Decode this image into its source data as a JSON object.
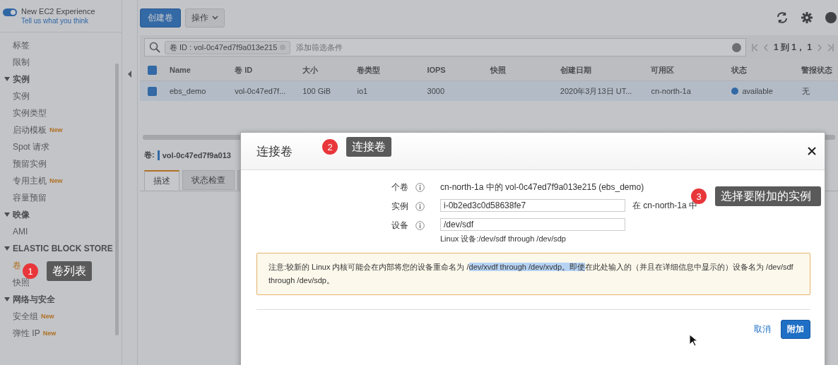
{
  "experience": {
    "label": "New EC2 Experience",
    "on": true,
    "link": "Tell us what you think"
  },
  "sidebar": {
    "items": [
      {
        "kind": "item",
        "label": "标签",
        "selected": false
      },
      {
        "kind": "item",
        "label": "限制",
        "selected": false
      },
      {
        "kind": "section",
        "label": "实例",
        "expanded": true,
        "children": [
          {
            "kind": "item",
            "label": "实例",
            "selected": false
          },
          {
            "kind": "item",
            "label": "实例类型",
            "selected": false
          },
          {
            "kind": "item",
            "label": "启动模板",
            "badge": "New",
            "selected": false
          },
          {
            "kind": "item",
            "label": "Spot 请求",
            "selected": false
          },
          {
            "kind": "item",
            "label": "预留实例",
            "selected": false
          },
          {
            "kind": "item",
            "label": "专用主机",
            "badge": "New",
            "selected": false
          },
          {
            "kind": "item",
            "label": "容量预留",
            "selected": false
          }
        ]
      },
      {
        "kind": "section",
        "label": "映像",
        "expanded": true,
        "children": [
          {
            "kind": "item",
            "label": "AMI",
            "selected": false
          }
        ]
      },
      {
        "kind": "section",
        "label": "ELASTIC BLOCK STORE",
        "expanded": true,
        "children": [
          {
            "kind": "item",
            "label": "卷",
            "selected": true
          },
          {
            "kind": "item",
            "label": "快照",
            "selected": false
          }
        ]
      },
      {
        "kind": "section",
        "label": "网络与安全",
        "expanded": true,
        "children": [
          {
            "kind": "item",
            "label": "安全组",
            "badge": "New",
            "selected": false
          },
          {
            "kind": "item",
            "label": "弹性 IP",
            "badge": "New",
            "selected": false
          }
        ]
      }
    ]
  },
  "toolbar": {
    "create_button": "创建卷",
    "actions_button": "操作"
  },
  "filter": {
    "token": "卷 ID : vol-0c47ed7f9a013e215",
    "placeholder": "添加筛选条件",
    "pager": "1 到 1， 1"
  },
  "table": {
    "select_all": {
      "checked": true
    },
    "columns": [
      "Name",
      "卷 ID",
      "大小",
      "卷类型",
      "IOPS",
      "快照",
      "创建日期",
      "可用区",
      "状态",
      "警报状态"
    ],
    "rows": [
      {
        "selected": true,
        "cells": [
          "ebs_demo",
          "vol-0c47ed7f...",
          "100 GiB",
          "io1",
          "3000",
          "",
          "2020年3月13日 UT...",
          "cn-north-1a",
          "available",
          "无"
        ]
      }
    ]
  },
  "detail": {
    "label": "卷:",
    "volume": "vol-0c47ed7f9a013",
    "tabs": [
      {
        "label": "描述",
        "selected": true
      },
      {
        "label": "状态检查",
        "selected": false
      },
      {
        "selected": false
      }
    ]
  },
  "dialog": {
    "title": "连接卷",
    "fields": [
      {
        "kind": "text",
        "label": "个卷",
        "value": "cn-north-1a 中的 vol-0c47ed7f9a013e215 (ebs_demo)"
      },
      {
        "kind": "input",
        "label": "实例",
        "value": "i-0b2ed3c0d58638fe7",
        "suffix": "在 cn-north-1a 中"
      },
      {
        "kind": "input",
        "label": "设备",
        "value": "/dev/sdf",
        "hint": "Linux 设备:/dev/sdf through /dev/sdp"
      }
    ],
    "note": [
      {
        "text": "注意:较新的 Linux 内核可能会在内部将您的设备重命名为 /",
        "selected": false
      },
      {
        "text": "dev/xvdf through /dev/xvdp。即使",
        "selected": true
      },
      {
        "text": "在此处输入的（并且在详细信息中显示的）设备名为 /dev/sdf through /dev/sdp。",
        "selected": false
      }
    ],
    "cancel": "取消",
    "attach": "附加"
  },
  "callouts": [
    {
      "number": "1",
      "text": "卷列表"
    },
    {
      "number": "2",
      "text": "连接卷"
    },
    {
      "number": "3",
      "text": "选择要附加的实例"
    }
  ]
}
